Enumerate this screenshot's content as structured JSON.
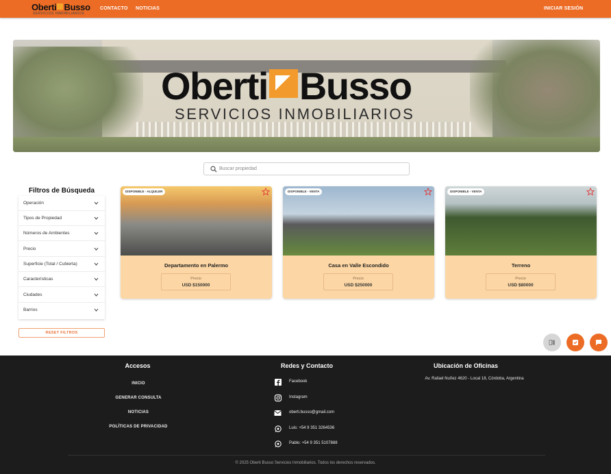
{
  "header": {
    "logo_text_1": "Oberti",
    "logo_text_2": "Busso",
    "logo_tagline": "SERVICIOS INMOBILIARIOS",
    "nav": [
      {
        "label": "CONTACTO"
      },
      {
        "label": "NOTICIAS"
      }
    ],
    "login_label": "INICIAR SESIÓN",
    "brand_color": "#ec6c26"
  },
  "hero": {
    "brand_1": "Oberti",
    "brand_2": "Busso",
    "tagline": "SERVICIOS INMOBILIARIOS"
  },
  "search": {
    "placeholder": "Buscar propiedad",
    "icon": "search-icon"
  },
  "filters": {
    "title": "Filtros de Búsqueda",
    "items": [
      {
        "label": "Operación"
      },
      {
        "label": "Tipos de Propiedad"
      },
      {
        "label": "Números de Ambientes"
      },
      {
        "label": "Precio"
      },
      {
        "label": "Superficie (Total / Cubierta)"
      },
      {
        "label": "Características"
      },
      {
        "label": "Ciudades"
      },
      {
        "label": "Barrios"
      }
    ],
    "reset_label": "RESET FILTROS"
  },
  "properties": [
    {
      "badge": "DISPONIBLE - ALQUILER",
      "title": "Departamento en Palermo",
      "price_label": "Precio",
      "price": "USD $150000"
    },
    {
      "badge": "DISPONIBLE - VENTA",
      "title": "Casa en Valle Escondido",
      "price_label": "Precio",
      "price": "USD $250000"
    },
    {
      "badge": "DISPONIBLE - VENTA",
      "title": "Terreno",
      "price_label": "Precio",
      "price": "USD $80000"
    }
  ],
  "footer": {
    "col1_title": "Accesos",
    "col2_title": "Redes y Contacto",
    "col3_title": "Ubicación de Oficinas",
    "links": [
      {
        "label": "INICIO"
      },
      {
        "label": "GENERAR CONSULTA"
      },
      {
        "label": "NOTICIAS"
      },
      {
        "label": "POLÍTICAS DE PRIVACIDAD"
      }
    ],
    "contacts": [
      {
        "icon": "facebook-icon",
        "text": "Facebook"
      },
      {
        "icon": "instagram-icon",
        "text": "Instagram"
      },
      {
        "icon": "mail-icon",
        "text": "oberti.busso@gmail.com"
      },
      {
        "icon": "whatsapp-icon",
        "text": "Luis: +54 9 351 3264536"
      },
      {
        "icon": "whatsapp-icon",
        "text": "Pablo: +54 9 351 5107888"
      }
    ],
    "address": "Av. Rafael Nuñez 4620 - Local 18, Córdoba, Argentina",
    "copyright": "© 2025 Oberti Busso Servicios Inmobiliarios. Todos los derechos reservados."
  }
}
